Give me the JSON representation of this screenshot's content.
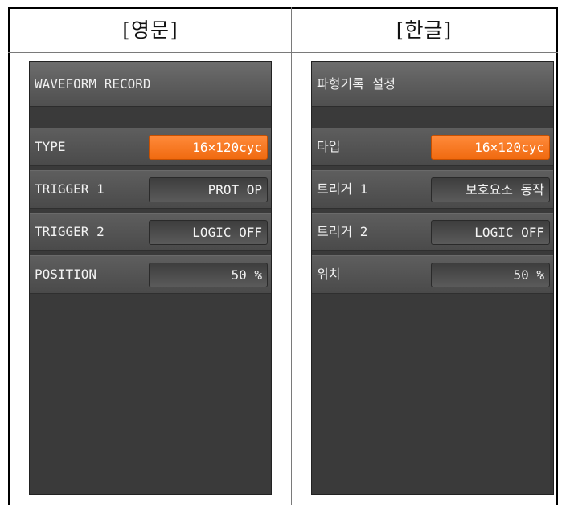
{
  "colors": {
    "accent": "#f06a10",
    "panel": "#3a3a3a",
    "row": "#4f4f4f"
  },
  "english": {
    "header": "[영문]",
    "screen_title": "WAVEFORM RECORD",
    "rows": [
      {
        "label": "TYPE",
        "value": "16×120cyc"
      },
      {
        "label": "TRIGGER 1",
        "value": "PROT OP"
      },
      {
        "label": "TRIGGER 2",
        "value": "LOGIC OFF"
      },
      {
        "label": "POSITION",
        "value": "50 %"
      }
    ]
  },
  "korean": {
    "header": "[한글]",
    "screen_title": "파형기록 설정",
    "rows": [
      {
        "label": "타입",
        "value": "16×120cyc"
      },
      {
        "label": "트리거 1",
        "value": "보호요소 동작"
      },
      {
        "label": "트리거 2",
        "value": "LOGIC OFF"
      },
      {
        "label": "위치",
        "value": "50 %"
      }
    ]
  }
}
